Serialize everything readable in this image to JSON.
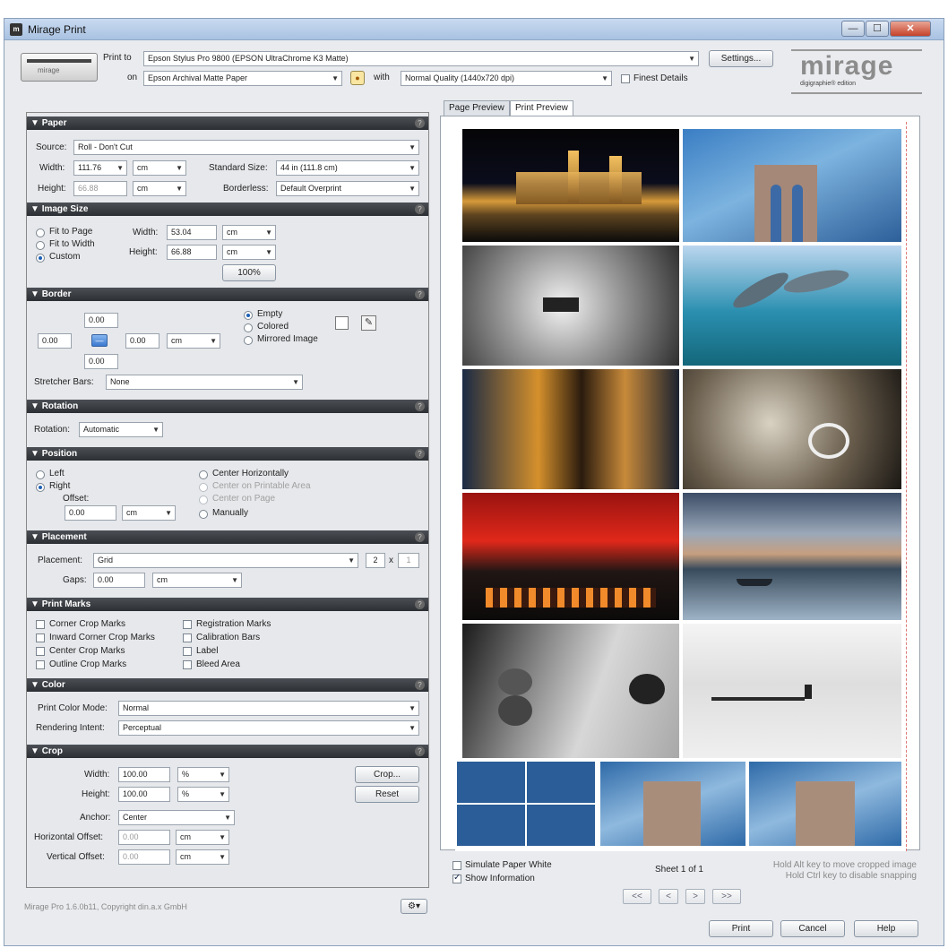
{
  "window": {
    "title": "Mirage Print",
    "app_icon": "mirage-app-icon",
    "controls": [
      "minimize",
      "maximize",
      "close"
    ]
  },
  "printer": {
    "icon_label": "mirage",
    "print_to_label": "Print to",
    "printer_value": "Epson Stylus Pro 9800 (EPSON UltraChrome K3 Matte)",
    "settings_button": "Settings...",
    "on_label": "on",
    "paper_value": "Epson Archival Matte Paper",
    "with_label": "with",
    "quality_value": "Normal Quality (1440x720 dpi)",
    "finest_details_label": "Finest Details",
    "finest_details_checked": false
  },
  "logo": {
    "text": "mirage",
    "sub": "digigraphie® edition"
  },
  "sections": {
    "paper": "Paper",
    "image_size": "Image Size",
    "border": "Border",
    "rotation": "Rotation",
    "position": "Position",
    "placement": "Placement",
    "print_marks": "Print Marks",
    "color": "Color",
    "crop": "Crop"
  },
  "paper": {
    "source_label": "Source:",
    "source_value": "Roll - Don't Cut",
    "width_label": "Width:",
    "width_value": "111.76",
    "width_unit": "cm",
    "standard_size_label": "Standard Size:",
    "standard_size_value": "44 in (111.8 cm)",
    "height_label": "Height:",
    "height_value": "66.88",
    "height_unit": "cm",
    "borderless_label": "Borderless:",
    "borderless_value": "Default Overprint"
  },
  "image_size": {
    "fit_to_page": "Fit to Page",
    "fit_to_width": "Fit to Width",
    "custom": "Custom",
    "selected": "custom",
    "width_label": "Width:",
    "width_value": "53.04",
    "width_unit": "cm",
    "height_label": "Height:",
    "height_value": "66.88",
    "height_unit": "cm",
    "percent_button": "100%"
  },
  "border": {
    "top": "0.00",
    "left": "0.00",
    "right": "0.00",
    "bottom": "0.00",
    "unit": "cm",
    "empty": "Empty",
    "colored": "Colored",
    "mirrored": "Mirrored Image",
    "selected": "empty",
    "stretcher_label": "Stretcher Bars:",
    "stretcher_value": "None"
  },
  "rotation": {
    "label": "Rotation:",
    "value": "Automatic"
  },
  "position": {
    "left": "Left",
    "right": "Right",
    "selected": "right",
    "offset_label": "Offset:",
    "offset_value": "0.00",
    "offset_unit": "cm",
    "center_h": "Center Horizontally",
    "center_printable": "Center on Printable Area",
    "center_page": "Center on Page",
    "manually": "Manually"
  },
  "placement": {
    "label": "Placement:",
    "value": "Grid",
    "cols": "2",
    "x": "x",
    "rows": "1",
    "gaps_label": "Gaps:",
    "gaps_value": "0.00",
    "gaps_unit": "cm"
  },
  "print_marks": {
    "corner_crop": "Corner Crop Marks",
    "inward_corner_crop": "Inward Corner Crop Marks",
    "center_crop": "Center Crop Marks",
    "outline_crop": "Outline Crop Marks",
    "registration": "Registration Marks",
    "calibration": "Calibration Bars",
    "label": "Label",
    "bleed": "Bleed Area"
  },
  "color": {
    "mode_label": "Print Color Mode:",
    "mode_value": "Normal",
    "intent_label": "Rendering Intent:",
    "intent_value": "Perceptual"
  },
  "crop": {
    "width_label": "Width:",
    "width_value": "100.00",
    "width_unit": "%",
    "height_label": "Height:",
    "height_value": "100.00",
    "height_unit": "%",
    "crop_button": "Crop...",
    "reset_button": "Reset",
    "anchor_label": "Anchor:",
    "anchor_value": "Center",
    "h_offset_label": "Horizontal Offset:",
    "h_offset_value": "0.00",
    "h_offset_unit": "cm",
    "v_offset_label": "Vertical Offset:",
    "v_offset_value": "0.00",
    "v_offset_unit": "cm"
  },
  "footer": {
    "copyright": "Mirage Pro 1.6.0b11, Copyright din.a.x GmbH",
    "gear_menu": "⚙▾",
    "print_button": "Print",
    "cancel_button": "Cancel",
    "help_button": "Help"
  },
  "preview": {
    "tabs": [
      "Page Preview",
      "Print Preview"
    ],
    "active_tab": "Print Preview",
    "simulate_paper_white": "Simulate Paper White",
    "simulate_checked": false,
    "show_information": "Show Information",
    "show_information_checked": true,
    "sheet_label": "Sheet 1 of 1",
    "hint_line1": "Hold Alt key to move cropped image",
    "hint_line2": "Hold Ctrl key to disable snapping",
    "nav_first": "<<",
    "nav_prev": "<",
    "nav_next": ">",
    "nav_last": ">>"
  }
}
